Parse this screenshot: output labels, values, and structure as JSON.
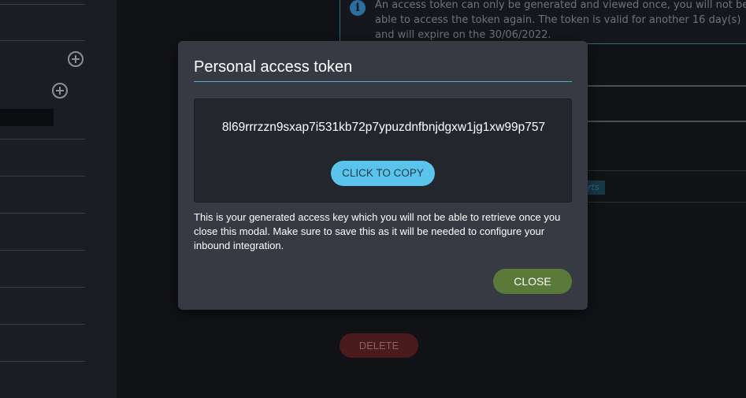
{
  "background": {
    "info_message": "An access token can only be generated and viewed once, you will not be able to access the token again. The token is valid for another 16 day(s) and will expire on the 30/06/2022.",
    "info_icon": "info-icon",
    "tag_text": "rts",
    "delete_label": "DELETE"
  },
  "modal": {
    "title": "Personal access token",
    "token": "8l69rrrzzn9sxap7i531kb72p7ypuzdnfbnjdgxw1jg1xw99p757",
    "copy_label": "CLICK TO COPY",
    "description": "This is your generated access key which you will not be able to retrieve once you close this modal. Make sure to save this as it will be needed to configure your inbound integration.",
    "close_label": "CLOSE"
  },
  "colors": {
    "accent": "#5bc4ec",
    "close_green": "#5b7a3a",
    "delete_red": "#4a1b1d",
    "modal_bg": "#373a43"
  }
}
